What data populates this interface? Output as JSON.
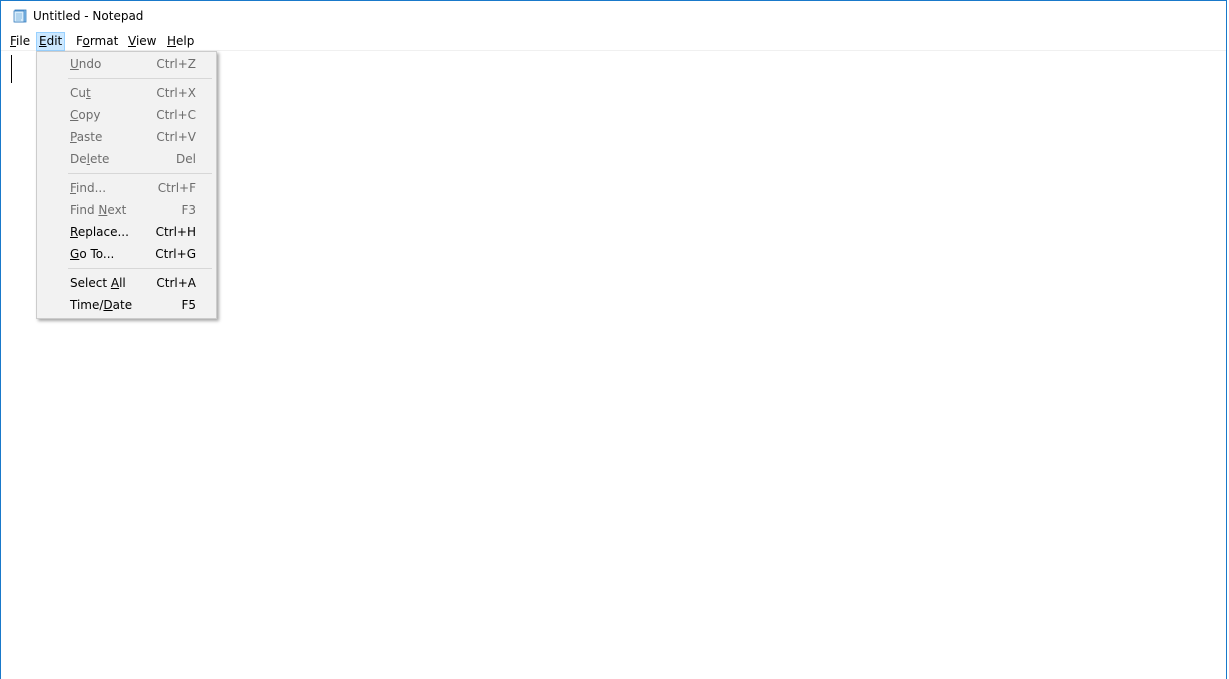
{
  "window": {
    "title": "Untitled - Notepad"
  },
  "menubar": {
    "items": [
      {
        "pre": "",
        "ul": "F",
        "post": "ile"
      },
      {
        "pre": "",
        "ul": "E",
        "post": "dit"
      },
      {
        "pre": "F",
        "ul": "o",
        "post": "rmat"
      },
      {
        "pre": "",
        "ul": "V",
        "post": "iew"
      },
      {
        "pre": "",
        "ul": "H",
        "post": "elp"
      }
    ],
    "active": "Edit"
  },
  "edit_menu": {
    "items": [
      {
        "pre": "",
        "ul": "U",
        "post": "ndo",
        "shortcut": "Ctrl+Z",
        "enabled": false
      },
      {
        "pre": "Cu",
        "ul": "t",
        "post": "",
        "shortcut": "Ctrl+X",
        "enabled": false
      },
      {
        "pre": "",
        "ul": "C",
        "post": "opy",
        "shortcut": "Ctrl+C",
        "enabled": false
      },
      {
        "pre": "",
        "ul": "P",
        "post": "aste",
        "shortcut": "Ctrl+V",
        "enabled": false
      },
      {
        "pre": "De",
        "ul": "l",
        "post": "ete",
        "shortcut": "Del",
        "enabled": false
      },
      {
        "pre": "",
        "ul": "F",
        "post": "ind...",
        "shortcut": "Ctrl+F",
        "enabled": false
      },
      {
        "pre": "Find ",
        "ul": "N",
        "post": "ext",
        "shortcut": "F3",
        "enabled": false
      },
      {
        "pre": "",
        "ul": "R",
        "post": "eplace...",
        "shortcut": "Ctrl+H",
        "enabled": true
      },
      {
        "pre": "",
        "ul": "G",
        "post": "o To...",
        "shortcut": "Ctrl+G",
        "enabled": true
      },
      {
        "pre": "Select ",
        "ul": "A",
        "post": "ll",
        "shortcut": "Ctrl+A",
        "enabled": true
      },
      {
        "pre": "Time/",
        "ul": "D",
        "post": "ate",
        "shortcut": "F5",
        "enabled": true
      }
    ]
  },
  "editor": {
    "content": ""
  },
  "icons": {
    "app": "notepad-icon"
  },
  "colors": {
    "window_border": "#1979ca",
    "menu_active_bg": "#cce8ff",
    "menu_active_border": "#99d1ff",
    "dropdown_bg": "#f2f2f2",
    "disabled_text": "#6d6d6d"
  }
}
